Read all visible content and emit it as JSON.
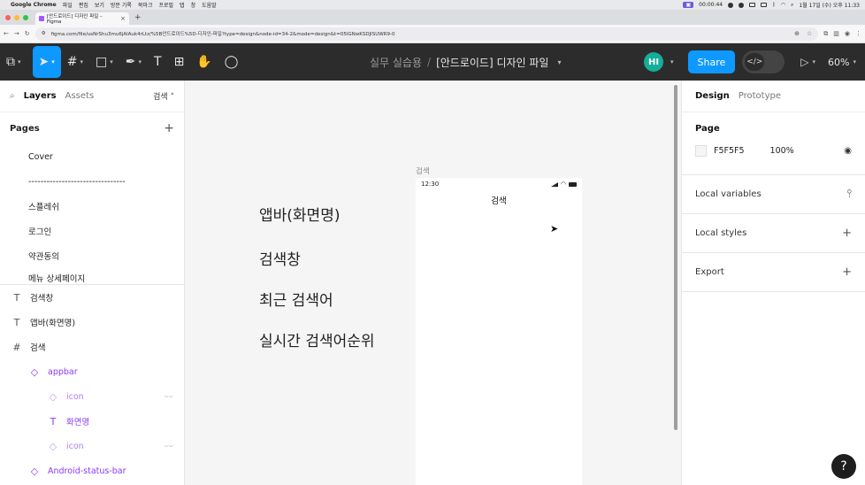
{
  "macos": {
    "apple": "",
    "app": "Google Chrome",
    "menus": [
      "파일",
      "편집",
      "보기",
      "방문 기록",
      "북마크",
      "프로필",
      "탭",
      "창",
      "도움말"
    ],
    "recording": "00:00:44",
    "clock": "1월 17일 (수) 오후 11:33"
  },
  "browser": {
    "tab_title": "[안드로이드] 디자인 파일 – Figma",
    "url": "figma.com/file/usNrShu3mu6jAlAuk4rLtz/%5B안드로이드%5D-디자인-파일?type=design&node-id=34-2&mode=design&t=05lGNwKSDJlSUWR9-0"
  },
  "toolbar": {
    "project": "실무 실습용",
    "separator": "/",
    "file": "[안드로이드] 디자인 파일",
    "avatar_initials": "HI",
    "share_label": "Share",
    "devmode_icon": "</>",
    "zoom": "60%"
  },
  "left_panel": {
    "tab_layers": "Layers",
    "tab_assets": "Assets",
    "current_page": "검색",
    "pages_title": "Pages",
    "pages": [
      "Cover",
      "--------------------------------",
      "스플레쉬",
      "로그인",
      "약관동의",
      "메뉴 상세페이지"
    ],
    "layers": [
      {
        "icon": "T",
        "name": "검색창",
        "indent": 0,
        "style": "normal"
      },
      {
        "icon": "T",
        "name": "앱바(화면명)",
        "indent": 0,
        "style": "normal"
      },
      {
        "icon": "#",
        "name": "검색",
        "indent": 0,
        "style": "normal"
      },
      {
        "icon": "◇",
        "name": "appbar",
        "indent": 1,
        "style": "purple"
      },
      {
        "icon": "◇",
        "name": "icon",
        "indent": 2,
        "style": "faded"
      },
      {
        "icon": "T",
        "name": "화면명",
        "indent": 2,
        "style": "purple"
      },
      {
        "icon": "◇",
        "name": "icon",
        "indent": 2,
        "style": "faded"
      },
      {
        "icon": "◇",
        "name": "Android-status-bar",
        "indent": 1,
        "style": "purple"
      }
    ]
  },
  "canvas": {
    "texts": [
      "앱바(화면명)",
      "검색창",
      "최근 검색어",
      "실시간 검색어순위"
    ],
    "frame_label": "검색",
    "frame_time": "12:30",
    "frame_title": "검색"
  },
  "right_panel": {
    "tab_design": "Design",
    "tab_prototype": "Prototype",
    "page_title": "Page",
    "page_color": "F5F5F5",
    "page_opacity": "100%",
    "local_variables": "Local variables",
    "local_styles": "Local styles",
    "export": "Export"
  },
  "help_label": "?"
}
